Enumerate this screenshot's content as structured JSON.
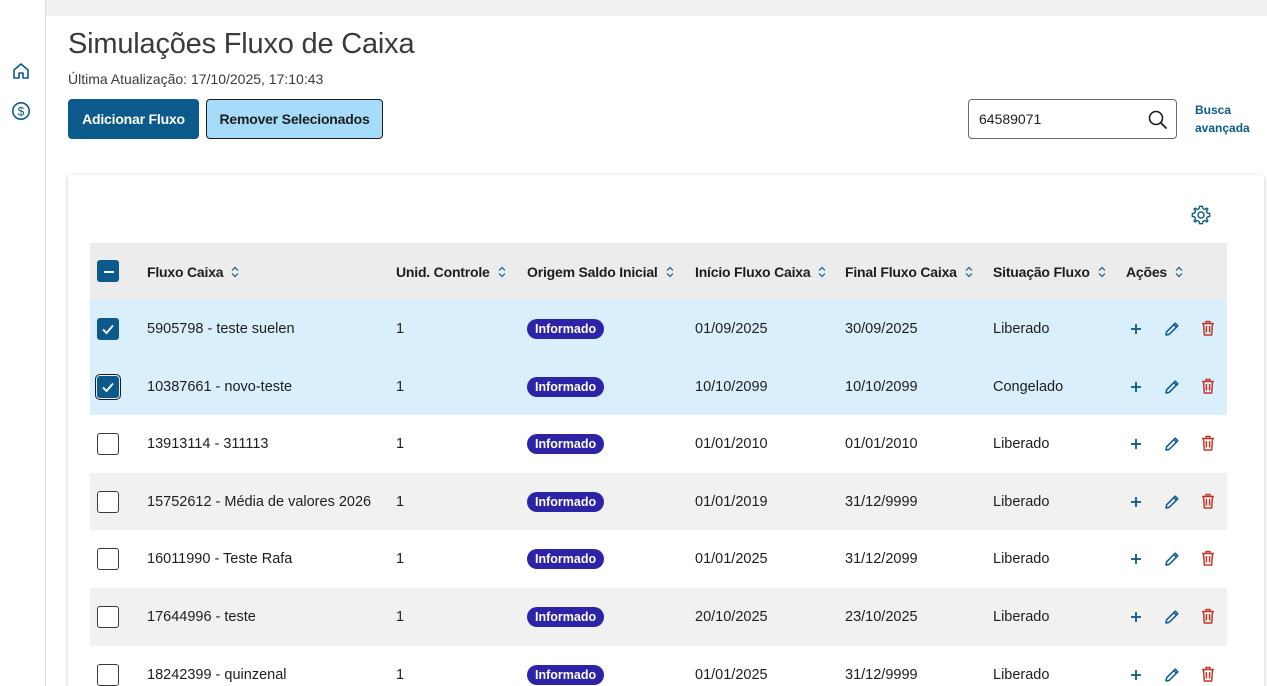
{
  "sidebar": {
    "items": [
      {
        "icon": "home-icon"
      },
      {
        "icon": "dollar-circle-icon"
      }
    ]
  },
  "header": {
    "title": "Simulações Fluxo de Caixa",
    "updated": "Última Atualização: 17/10/2025, 17:10:43"
  },
  "toolbar": {
    "add_label": "Adicionar Fluxo",
    "remove_label": "Remover Selecionados"
  },
  "search": {
    "value": "64589071",
    "advanced_line1": "Busca",
    "advanced_line2": "avançada"
  },
  "colors": {
    "primary": "#0c5a8c",
    "secondary": "#a6dcfa",
    "tag": "#2d23a6",
    "selected_row": "#d9effc",
    "delete": "#c0392b"
  },
  "table": {
    "columns": [
      "Fluxo Caixa",
      "Unid. Controle",
      "Origem Saldo Inicial",
      "Início Fluxo Caixa",
      "Final Fluxo Caixa",
      "Situação Fluxo",
      "Ações"
    ],
    "rows": [
      {
        "fluxo": "5905798 - teste suelen",
        "unid": "1",
        "origem": "Informado",
        "inicio": "01/09/2025",
        "final": "30/09/2025",
        "situacao": "Liberado",
        "checked": true
      },
      {
        "fluxo": "10387661 - novo-teste",
        "unid": "1",
        "origem": "Informado",
        "inicio": "10/10/2099",
        "final": "10/10/2099",
        "situacao": "Congelado",
        "checked": true
      },
      {
        "fluxo": "13913114 - 311113",
        "unid": "1",
        "origem": "Informado",
        "inicio": "01/01/2010",
        "final": "01/01/2010",
        "situacao": "Liberado",
        "checked": false
      },
      {
        "fluxo": "15752612 - Média de valores 2026",
        "unid": "1",
        "origem": "Informado",
        "inicio": "01/01/2019",
        "final": "31/12/9999",
        "situacao": "Liberado",
        "checked": false
      },
      {
        "fluxo": "16011990 - Teste Rafa",
        "unid": "1",
        "origem": "Informado",
        "inicio": "01/01/2025",
        "final": "31/12/2099",
        "situacao": "Liberado",
        "checked": false
      },
      {
        "fluxo": "17644996 - teste",
        "unid": "1",
        "origem": "Informado",
        "inicio": "20/10/2025",
        "final": "23/10/2025",
        "situacao": "Liberado",
        "checked": false
      },
      {
        "fluxo": "18242399 - quinzenal",
        "unid": "1",
        "origem": "Informado",
        "inicio": "01/01/2025",
        "final": "31/12/9999",
        "situacao": "Liberado",
        "checked": false
      }
    ]
  }
}
